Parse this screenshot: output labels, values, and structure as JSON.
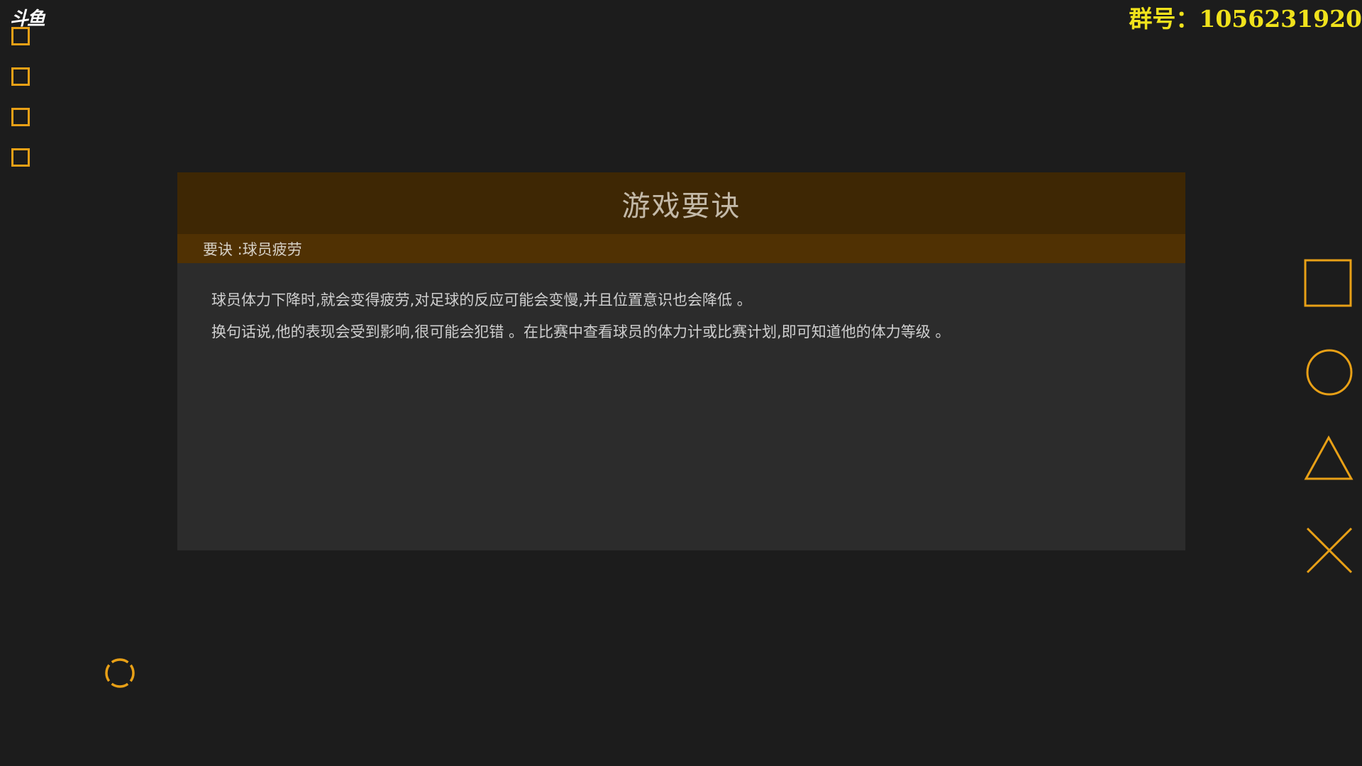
{
  "overlay": {
    "watermark": "斗鱼",
    "group_id": "群号：1056231920"
  },
  "tip": {
    "title": "游戏要诀",
    "subtitle": "要诀 :球员疲劳",
    "lines": [
      "球员体力下降时,就会变得疲劳,对足球的反应可能会变慢,并且位置意识也会降低 。",
      "换句话说,他的表现会受到影响,很可能会犯错 。在比赛中查看球员的体力计或比赛计划,即可知道他的体力等级 。"
    ]
  },
  "controls": {
    "icons": [
      "square-button-icon",
      "circle-button-icon",
      "triangle-button-icon",
      "cross-button-icon",
      "target-button-icon"
    ]
  },
  "colors": {
    "accent": "#e8a016",
    "header_bg": "#3e2704",
    "subbar_bg": "#503103",
    "panel_bg": "#2c2c2c",
    "group_id": "#f0e21c"
  }
}
